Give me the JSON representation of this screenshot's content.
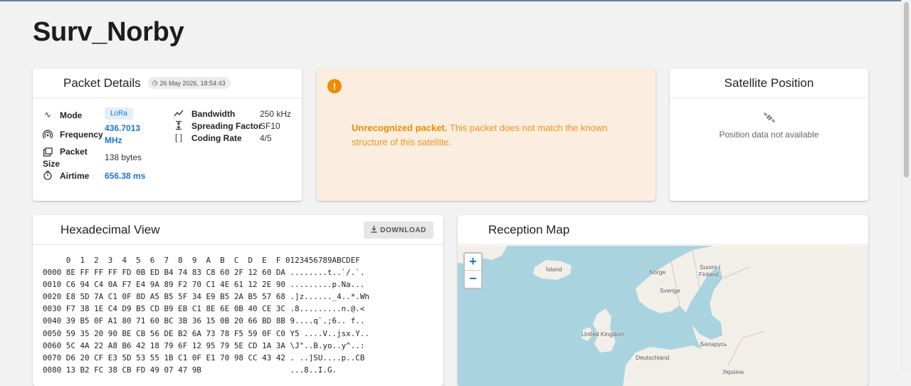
{
  "page": {
    "title": "Surv_Norby"
  },
  "packet_details": {
    "title": "Packet Details",
    "timestamp": "26 May 2026, 18:54:43",
    "mode_label": "Mode",
    "mode_value": "LoRa",
    "frequency_label": "Frequency",
    "frequency_value_line1": "436.7013",
    "frequency_value_line2": "MHz",
    "packet_size_label_line1": "Packet",
    "packet_size_label_line2": "Size",
    "packet_size_value": "138 bytes",
    "airtime_label": "Airtime",
    "airtime_value": "656.38 ms",
    "bandwidth_label": "Bandwidth",
    "bandwidth_value": "250 kHz",
    "spreading_factor_label": "Spreading Factor",
    "spreading_factor_value": "SF10",
    "coding_rate_label": "Coding Rate",
    "coding_rate_value": "4/5"
  },
  "warning": {
    "bold": "Unrecognized packet.",
    "text": " This packet does not match the known structure of this satellite."
  },
  "satellite_position": {
    "title": "Satellite Position",
    "message": "Position data not available"
  },
  "hex_view": {
    "title": "Hexadecimal View",
    "download_label": "DOWNLOAD",
    "header": "     0  1  2  3  4  5  6  7  8  9  A  B  C  D  E  F 0123456789ABCDEF",
    "rows": [
      "0000 8E FF FF FF FD 0B ED B4 74 83 C8 60 2F 12 60 DA ........t..`/.`.",
      "0010 C6 94 C4 0A F7 E4 9A 89 F2 70 C1 4E 61 12 2E 90 .........p.Na...",
      "0020 E8 5D 7A C1 0F 8D A5 B5 5F 34 E9 B5 2A B5 57 68 .]z......_4..*.Wh",
      "0030 F7 38 1E C4 D9 B5 CD B9 EB C1 8E 6E 0B 40 CE 3C .8.........n.@.<",
      "0040 39 B5 0F A1 80 71 60 BC 3B 36 15 0B 20 66 BD 8B 9....q`.;6.. f..",
      "0050 59 35 20 90 BE CB 56 DE B2 6A 73 78 F5 59 0F C0 Y5 ....V..jsx.Y..",
      "0060 5C 4A 22 A8 B6 42 18 79 6F 12 95 79 5E CD 1A 3A \\J\"..B.yo..y^..:",
      "0070 D6 20 CF E3 5D 53 55 1B C1 0F E1 70 98 CC 43 42 . ..]SU....p..CB",
      "0080 13 B2 FC 38 CB FD 49 07 47 9B                   ...8..I.G."
    ]
  },
  "reception_map": {
    "title": "Reception Map",
    "zoom_in": "+",
    "zoom_out": "−",
    "labels": {
      "island": "Ísland",
      "norge": "Norge",
      "suomi_line1": "Suomi /",
      "suomi_line2": "Finland",
      "sverige": "Sverige",
      "uk": "United Kingdom",
      "belarus": "Беларусь",
      "deutschland": "Deutschland",
      "ukraine": "Україна"
    }
  }
}
